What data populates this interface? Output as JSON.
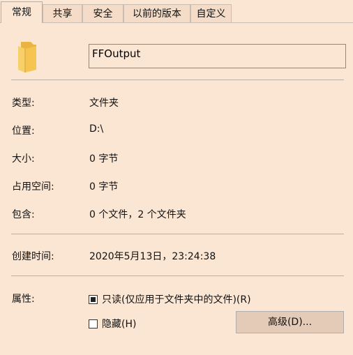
{
  "tabs": [
    {
      "label": "常规",
      "active": true
    },
    {
      "label": "共享",
      "active": false
    },
    {
      "label": "安全",
      "active": false
    },
    {
      "label": "以前的版本",
      "active": false
    },
    {
      "label": "自定义",
      "active": false
    }
  ],
  "folder": {
    "name": "FFOutput",
    "icon": "folder-icon"
  },
  "properties": {
    "type_label": "类型:",
    "type_value": "文件夹",
    "location_label": "位置:",
    "location_value": "D:\\",
    "size_label": "大小:",
    "size_value": "0 字节",
    "disk_size_label": "占用空间:",
    "disk_size_value": "0 字节",
    "contains_label": "包含:",
    "contains_value": "0 个文件，2 个文件夹",
    "created_label": "创建时间:",
    "created_value": "2020年5月13日，23:24:38",
    "attributes_label": "属性:"
  },
  "attributes": {
    "readonly_label": "只读(仅应用于文件夹中的文件)(R)",
    "readonly_state": "indeterminate",
    "hidden_label": "隐藏(H)",
    "hidden_checked": false,
    "advanced_button": "高级(D)..."
  },
  "colors": {
    "background": "#fbe6d4",
    "folder": "#f5c451"
  }
}
